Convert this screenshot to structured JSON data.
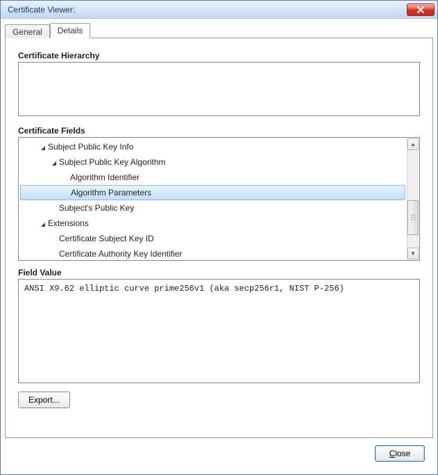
{
  "window": {
    "title": "Certificate Viewer:"
  },
  "tabs": {
    "general": "General",
    "details": "Details",
    "active": "details"
  },
  "sections": {
    "hierarchy": "Certificate Hierarchy",
    "fields": "Certificate Fields",
    "value": "Field Value"
  },
  "tree": {
    "rows": [
      {
        "label": "Subject Public Key Info",
        "depth": 1,
        "expanded": true,
        "hasChildren": true,
        "selected": false
      },
      {
        "label": "Subject Public Key Algorithm",
        "depth": 2,
        "expanded": true,
        "hasChildren": true,
        "selected": false
      },
      {
        "label": "Algorithm Identifier",
        "depth": 3,
        "expanded": false,
        "hasChildren": false,
        "selected": false
      },
      {
        "label": "Algorithm Parameters",
        "depth": 3,
        "expanded": false,
        "hasChildren": false,
        "selected": true
      },
      {
        "label": "Subject's Public Key",
        "depth": 2,
        "expanded": false,
        "hasChildren": false,
        "selected": false
      },
      {
        "label": "Extensions",
        "depth": 1,
        "expanded": true,
        "hasChildren": true,
        "selected": false
      },
      {
        "label": "Certificate Subject Key ID",
        "depth": 2,
        "expanded": false,
        "hasChildren": false,
        "selected": false
      },
      {
        "label": "Certificate Authority Key Identifier",
        "depth": 2,
        "expanded": false,
        "hasChildren": false,
        "selected": false
      }
    ]
  },
  "field_value": "ANSI X9.62 elliptic curve prime256v1 (aka secp256r1, NIST P-256)",
  "buttons": {
    "export": "Export...",
    "close_prefix": "",
    "close_key": "C",
    "close_suffix": "lose"
  }
}
